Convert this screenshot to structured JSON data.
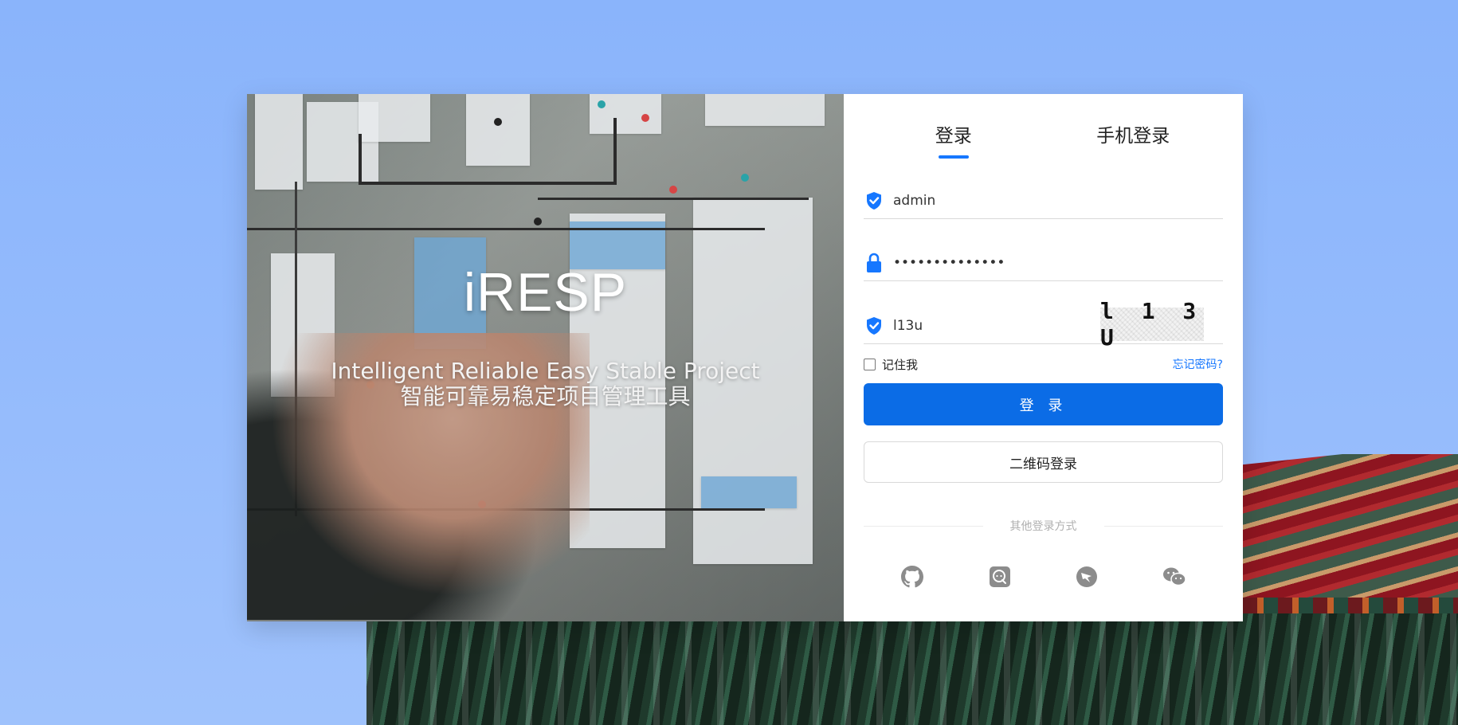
{
  "brand": {
    "logo": "iRESP",
    "subtitle_en": "Intelligent Reliable Easy Stable Project",
    "subtitle_zh": "智能可靠易稳定项目管理工具"
  },
  "tabs": [
    {
      "label": "登录",
      "active": true
    },
    {
      "label": "手机登录",
      "active": false
    }
  ],
  "form": {
    "username": {
      "value": "admin",
      "icon": "shield-check-icon"
    },
    "password": {
      "value": "••••••••••••••",
      "icon": "lock-icon"
    },
    "captcha": {
      "value": "l13u",
      "image_text": "l 1 3 U",
      "icon": "shield-check-icon"
    },
    "remember_label": "记住我",
    "forgot_label": "忘记密码?",
    "login_button": "登 录",
    "qr_button": "二维码登录"
  },
  "other_login": {
    "label": "其他登录方式",
    "providers": [
      {
        "name": "github",
        "icon": "github-icon"
      },
      {
        "name": "chat",
        "icon": "chat-bubble-icon"
      },
      {
        "name": "bird",
        "icon": "bird-icon"
      },
      {
        "name": "wechat",
        "icon": "wechat-icon"
      }
    ]
  },
  "colors": {
    "accent": "#1677ff",
    "button": "#0b6ce6",
    "icon_gray": "#8c8c8c"
  }
}
